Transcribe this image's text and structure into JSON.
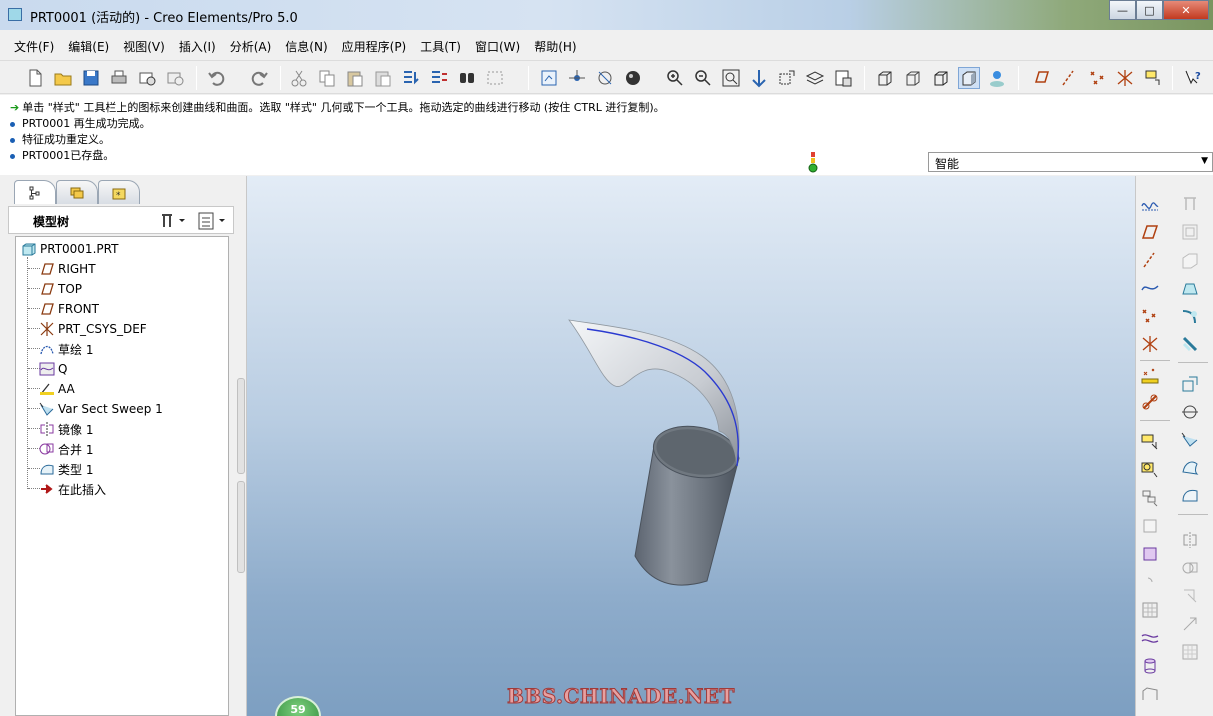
{
  "window": {
    "title": "PRT0001 (活动的) - Creo Elements/Pro 5.0",
    "minimize": "—",
    "maximize": "□",
    "close": "✕"
  },
  "menu": [
    "文件(F)",
    "编辑(E)",
    "视图(V)",
    "插入(I)",
    "分析(A)",
    "信息(N)",
    "应用程序(P)",
    "工具(T)",
    "窗口(W)",
    "帮助(H)"
  ],
  "messages": {
    "prompt": "单击 \"样式\" 工具栏上的图标来创建曲线和曲面。选取 \"样式\" 几何或下一个工具。拖动选定的曲线进行移动 (按住 CTRL 进行复制)。",
    "lines": [
      "PRT0001 再生成功完成。",
      "特征成功重定义。",
      "PRT0001已存盘。"
    ]
  },
  "filter": {
    "value": "智能"
  },
  "model_tree": {
    "title": "模型树",
    "root": "PRT0001.PRT",
    "items": [
      {
        "label": "RIGHT",
        "icon": "datum-plane-icon"
      },
      {
        "label": "TOP",
        "icon": "datum-plane-icon"
      },
      {
        "label": "FRONT",
        "icon": "datum-plane-icon"
      },
      {
        "label": "PRT_CSYS_DEF",
        "icon": "csys-icon"
      },
      {
        "label": "草绘 1",
        "icon": "sketch-icon"
      },
      {
        "label": "Q",
        "icon": "style-feature-icon"
      },
      {
        "label": "AA",
        "icon": "datum-axis-icon"
      },
      {
        "label": "Var Sect Sweep 1",
        "icon": "var-sect-sweep-icon"
      },
      {
        "label": "镜像 1",
        "icon": "mirror-icon"
      },
      {
        "label": "合并 1",
        "icon": "merge-icon"
      },
      {
        "label": "类型 1",
        "icon": "style-surface-icon"
      },
      {
        "label": "在此插入",
        "icon": "insert-here-arrow-icon"
      }
    ]
  },
  "viewport": {
    "watermark": "BBS.CHINADE.NET",
    "badge": "59"
  },
  "colors": {
    "accent": "#1a5fb4",
    "close_red": "#c23a20",
    "insert_arrow": "#b01818"
  }
}
